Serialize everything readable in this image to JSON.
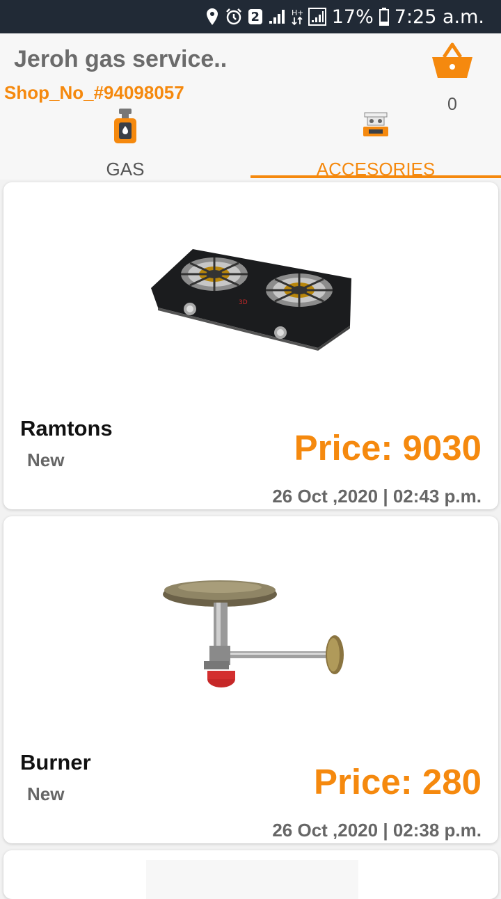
{
  "status_bar": {
    "sim_badge": "2",
    "battery": "17%",
    "time": "7:25 a.m."
  },
  "header": {
    "title": "Jeroh gas service..",
    "shop_no": "Shop_No_#94098057",
    "cart_count": "0"
  },
  "tabs": [
    {
      "label": "GAS",
      "icon": "gas-cylinder-icon",
      "selected": false
    },
    {
      "label": "ACCESORIES",
      "icon": "gas-stove-icon",
      "selected": true
    }
  ],
  "products": [
    {
      "name": "Ramtons",
      "condition": "New",
      "price": "Price: 9030",
      "date": "26 Oct ,2020 | 02:43 p.m.",
      "image": "double-burner-gas-stove"
    },
    {
      "name": "Burner",
      "condition": "New",
      "price": "Price: 280",
      "date": "26 Oct ,2020 | 02:38 p.m.",
      "image": "single-gas-burner"
    }
  ],
  "colors": {
    "accent": "#f5890e",
    "status_bar": "#212a36",
    "header_bg": "#f7f7f7",
    "page_bg": "#f2f2f2"
  }
}
